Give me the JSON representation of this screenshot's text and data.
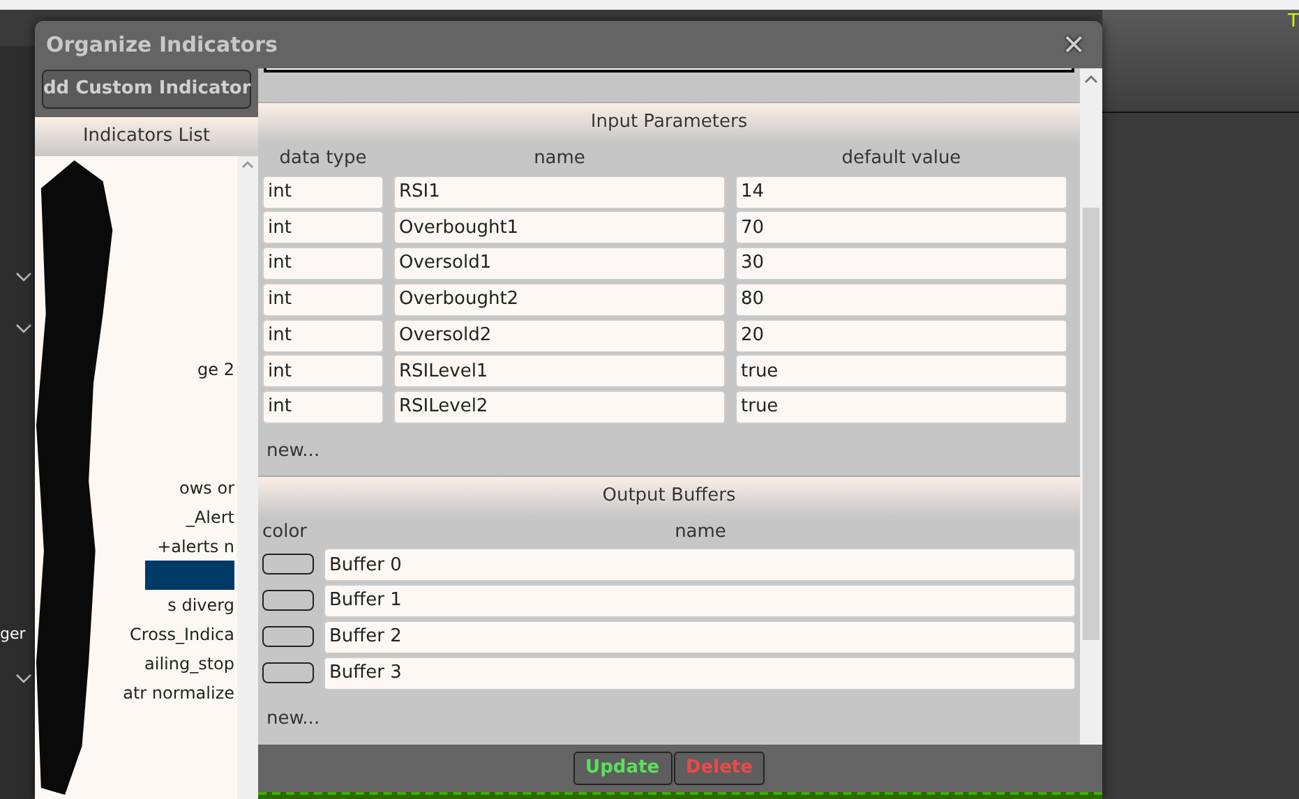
{
  "corner_letter": "T",
  "dialog": {
    "title": "Organize Indicators",
    "close": "✕"
  },
  "sidebar": {
    "add_button": "dd Custom Indicator",
    "list_header": "Indicators List",
    "side_text": "ger",
    "items": [
      {
        "text": "ge 2",
        "selected": false
      },
      {
        "text": "ows or",
        "selected": false
      },
      {
        "text": "_Alert",
        "selected": false
      },
      {
        "text": "+alerts n",
        "selected": false
      },
      {
        "selected": true
      },
      {
        "text": "s diverg",
        "selected": false
      },
      {
        "text": "Cross_Indica",
        "selected": false
      },
      {
        "text": "ailing_stop",
        "selected": false
      },
      {
        "text": "atr normalize",
        "selected": false
      }
    ]
  },
  "input_parameters": {
    "title": "Input Parameters",
    "columns": [
      "data type",
      "name",
      "default value"
    ],
    "rows": [
      {
        "data_type": "int",
        "name": "RSI1",
        "default_value": "14"
      },
      {
        "data_type": "int",
        "name": "Overbought1",
        "default_value": "70"
      },
      {
        "data_type": "int",
        "name": "Oversold1",
        "default_value": "30"
      },
      {
        "data_type": "int",
        "name": "Overbought2",
        "default_value": "80"
      },
      {
        "data_type": "int",
        "name": "Oversold2",
        "default_value": "20"
      },
      {
        "data_type": "int",
        "name": "RSILevel1",
        "default_value": "true"
      },
      {
        "data_type": "int",
        "name": "RSILevel2",
        "default_value": "true"
      }
    ],
    "new_link": "new..."
  },
  "output_buffers": {
    "title": "Output Buffers",
    "columns": [
      "color",
      "name"
    ],
    "rows": [
      {
        "name": "Buffer 0"
      },
      {
        "name": "Buffer 1"
      },
      {
        "name": "Buffer 2"
      },
      {
        "name": "Buffer 3"
      }
    ],
    "new_link": "new..."
  },
  "buttons": [
    {
      "label": "Update",
      "kind": "update"
    },
    {
      "label": "Delete",
      "kind": "delete"
    }
  ]
}
